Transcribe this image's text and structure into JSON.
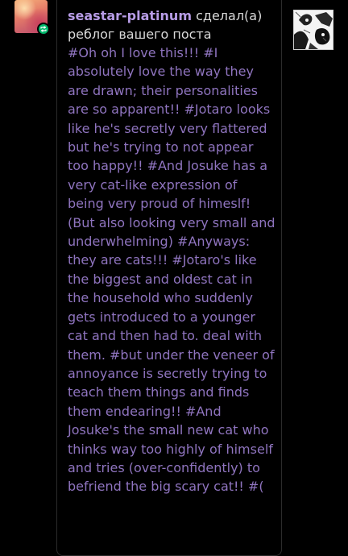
{
  "notification": {
    "username": "seastar-platinum",
    "action_line1": "сделал(а)",
    "action_line2": "реблог вашего поста",
    "comment_text": "#Oh oh I love this!!! #I absolutely love the way they are drawn; their personalities are so apparent!! #Jotaro looks like he's secretly very flattered but he's trying to not appear too happy!! #And Josuke has a very cat-like expression of being very proud of himeslf! (But also looking very small and underwhelming) #Anyways: they are cats!!! #Jotaro's like the biggest and oldest cat in the household who suddenly gets introduced to a younger cat and then had to. deal with them. #but under the veneer of annoyance is secretly trying to teach them things and finds them endearing!! #And Josuke's the small new cat who thinks way too highly of himself and tries (over-confidently) to befriend the big scary cat!! #("
  },
  "colors": {
    "background": "#000000",
    "username": "#b79ce6",
    "action_text": "#d9d9d9",
    "comment_text": "#8f74bf",
    "reblog_badge": "#00b86b",
    "card_border": "#2b2b2b"
  },
  "icons": {
    "reblog_badge": "reblog-icon",
    "post_thumbnail": "post-thumbnail-image"
  }
}
